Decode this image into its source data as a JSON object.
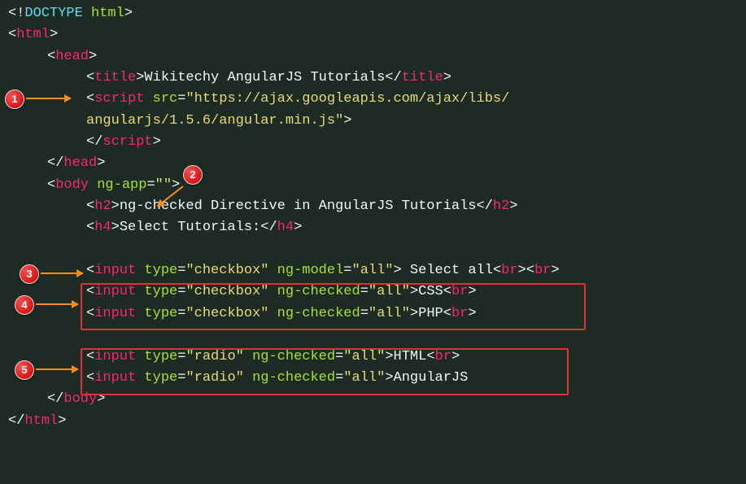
{
  "code": {
    "doctype": "<!DOCTYPE html>",
    "htmlOpen": "html",
    "headOpen": "head",
    "titleOpen": "title",
    "titleText": "Wikitechy AngularJS Tutorials",
    "titleClose": "title",
    "scriptOpen": "script",
    "srcAttr": "src",
    "srcVal1": "\"https://ajax.googleapis.com/ajax/libs/",
    "srcVal2": "angularjs/1.5.6/angular.min.js\"",
    "scriptClose": "script",
    "headClose": "head",
    "bodyOpen": "body",
    "ngApp": "ng-app",
    "ngAppVal": "\"\"",
    "h2": "h2",
    "h2Text": "ng-checked Directive in AngularJS Tutorials",
    "h4": "h4",
    "h4Text": "Select Tutorials:",
    "input": "input",
    "typeAttr": "type",
    "checkbox": "\"checkbox\"",
    "radio": "\"radio\"",
    "ngModel": "ng-model",
    "ngChecked": "ng-checked",
    "allVal": "\"all\"",
    "selectAll": " Select all",
    "css": "CSS",
    "php": "PHP",
    "html": "HTML",
    "angularjs": "AngularJS",
    "br": "br",
    "bodyClose": "body",
    "htmlClose": "html"
  },
  "callouts": {
    "c1": "1",
    "c2": "2",
    "c3": "3",
    "c4": "4",
    "c5": "5"
  }
}
